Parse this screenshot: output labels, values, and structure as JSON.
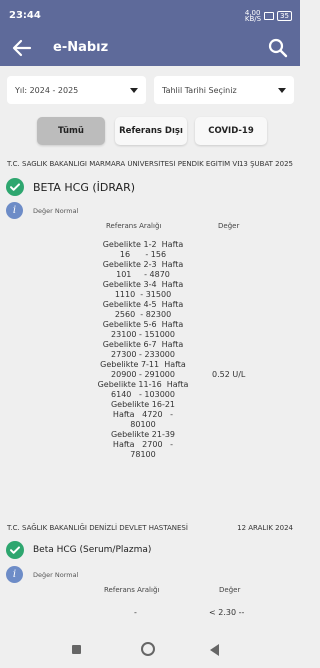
{
  "status": {
    "time": "23:44",
    "battery": "35",
    "speed": "4,00\nKB/S"
  },
  "app_bar": {
    "title": "e-Nabız"
  },
  "filters": {
    "year_label": "Yıl: 2024 - 2025",
    "date_label": "Tahlil Tarihi Seçiniz"
  },
  "tabs": [
    {
      "label": "Tümü"
    },
    {
      "label": "Referans Dışı"
    },
    {
      "label": "COVID-19"
    }
  ],
  "results": [
    {
      "hospital": "T.C. SAĞLIK BAKANLIĞI MARMARA ÜNİVERSİTESİ PENDİK EĞİTİM VE",
      "date": "13 ŞUBAT 2025",
      "test_name": "BETA HCG (İDRAR)",
      "status_label": "Değer Normal",
      "range_header": "Referans Aralığı",
      "value_header": "Değer",
      "reference_range": "Gebelikte 1-2  Hafta\n16      - 156\nGebelikte 2-3  Hafta\n101     - 4870\nGebelikte 3-4  Hafta\n1110  - 31500\nGebelikte 4-5  Hafta\n2560  - 82300\nGebelikte 5-6  Hafta\n23100 - 151000\nGebelikte 6-7  Hafta\n27300 - 233000\nGebelikte 7-11  Hafta\n20900 - 291000\nGebelikte 11-16  Hafta\n6140   - 103000\nGebelikte 16-21\nHafta   4720   -\n80100\nGebelikte 21-39\nHafta   2700   -\n78100",
      "value": "0.52 U/L"
    },
    {
      "hospital": "T.C. SAĞLIK BAKANLIĞI DENİZLİ DEVLET HASTANESİ",
      "date": "12 ARALIK 2024",
      "test_name": "Beta HCG (Serum/Plazma)",
      "status_label": "Değer Normal",
      "range_header": "Referans Aralığı",
      "value_header": "Değer",
      "reference_range": "-",
      "value": "< 2.30 --"
    }
  ],
  "colors": {
    "app_bar": "#5e6a9a",
    "check": "#2ea66f",
    "info": "#6d8cc7",
    "active_tab": "#bcbcbc"
  }
}
